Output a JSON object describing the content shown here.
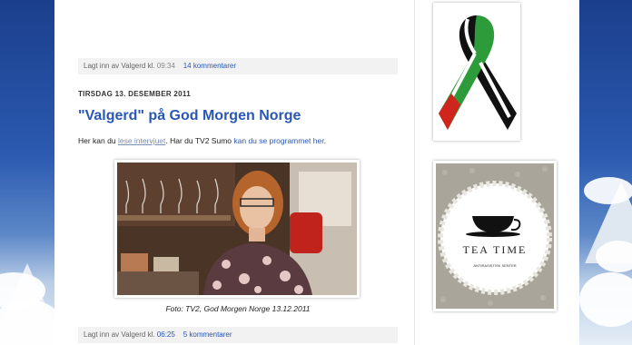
{
  "post1": {
    "footer_prefix": "Lagt inn av Valgerd kl.",
    "footer_time": "09:34",
    "footer_comments": "14 kommentarer"
  },
  "post2": {
    "date": "TIRSDAG 13. DESEMBER 2011",
    "title": "\"Valgerd\" på God Morgen Norge",
    "body_text1": "Her kan du ",
    "body_link1": "lese intervjuet",
    "body_text2": ". Har du TV2 Sumo ",
    "body_link2": "kan du se programmet her",
    "body_text3": ".",
    "caption": "Foto: TV2, God Morgen Norge 13.12.2011",
    "footer_prefix": "Lagt inn av Valgerd kl.",
    "footer_time": "06:25",
    "footer_comments": "5 kommentarer"
  },
  "sidebar": {
    "tea_title": "TEA TIME",
    "tea_subtitle": "ANTIRASISTISK SENTER"
  },
  "colors": {
    "link": "#2a57b5",
    "footer_bg": "#f2f2f2",
    "ribbon_green": "#2e9b3a",
    "ribbon_red": "#d0251c",
    "ribbon_black": "#111111"
  }
}
